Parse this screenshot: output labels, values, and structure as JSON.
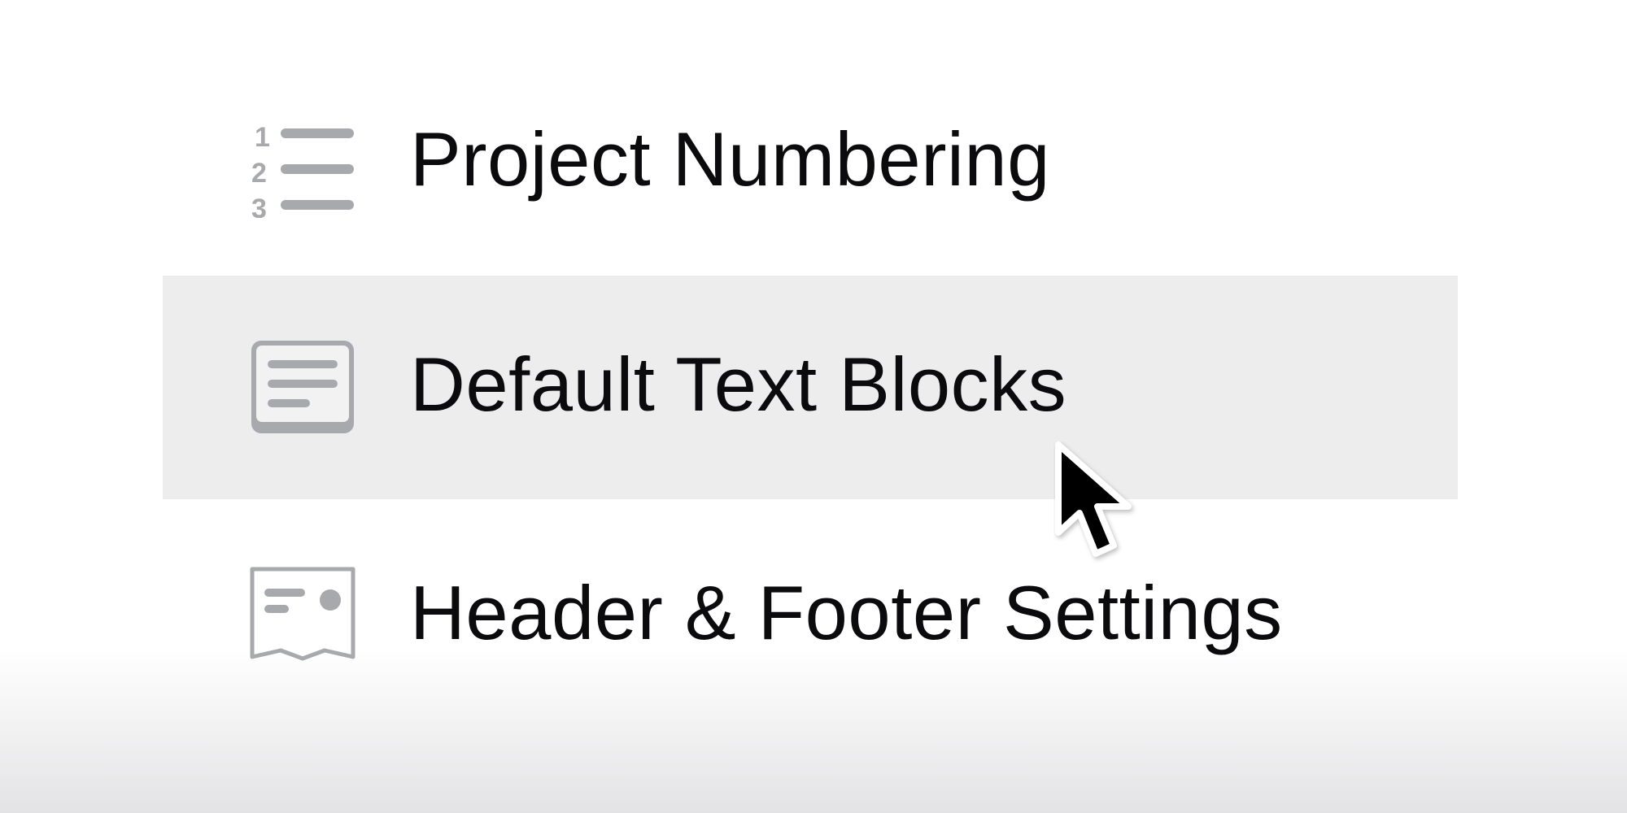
{
  "menu": {
    "items": [
      {
        "label": "Project Numbering",
        "icon": "numbered-list-icon",
        "highlighted": false
      },
      {
        "label": "Default Text Blocks",
        "icon": "text-block-icon",
        "highlighted": true
      },
      {
        "label": "Header & Footer Settings",
        "icon": "header-footer-icon",
        "highlighted": false
      }
    ]
  },
  "colors": {
    "icon": "#a8a9ad",
    "text": "#0b0b0d",
    "highlight": "#ededed"
  }
}
